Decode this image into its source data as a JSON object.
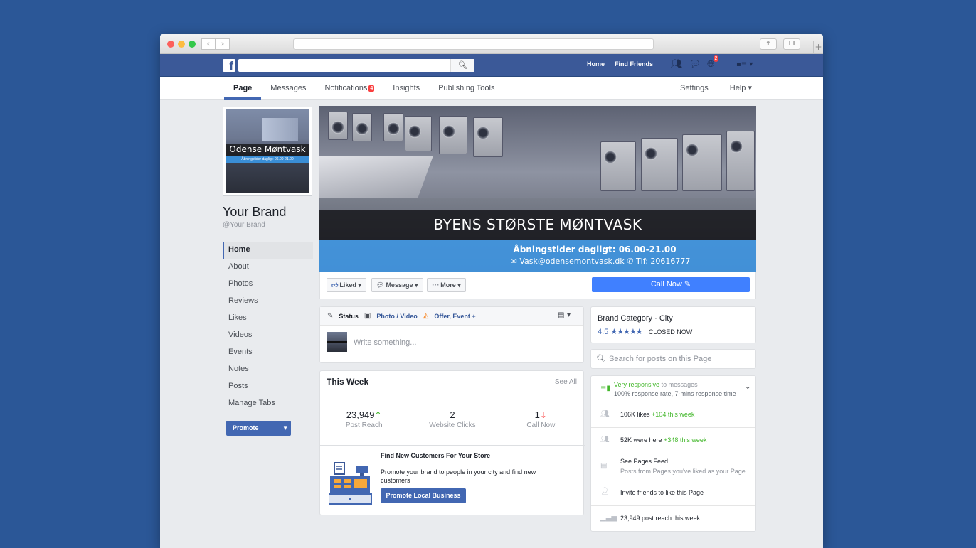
{
  "browser": {
    "back": "‹",
    "forward": "›"
  },
  "fbbar": {
    "logo": "f",
    "links": [
      "Home",
      "Find Friends"
    ],
    "requests_icon": "friends-icon",
    "messages_icon": "messages-icon",
    "notifications_icon": "globe-icon",
    "notifications_count": "2"
  },
  "pagenav": {
    "tabs": [
      {
        "label": "Page",
        "active": true
      },
      {
        "label": "Messages"
      },
      {
        "label": "Notifications",
        "badge": "4"
      },
      {
        "label": "Insights"
      },
      {
        "label": "Publishing Tools"
      }
    ],
    "right": [
      "Settings",
      "Help ▾"
    ]
  },
  "profile": {
    "avatar_name": "Odense Møntvask",
    "avatar_hours": "Åbningstider dagligt: 06.00-21.00",
    "name": "Your Brand",
    "handle": "@Your Brand"
  },
  "sidebar": {
    "items": [
      "Home",
      "About",
      "Photos",
      "Reviews",
      "Likes",
      "Videos",
      "Events",
      "Notes",
      "Posts",
      "Manage Tabs"
    ],
    "promote": "Promote"
  },
  "cover": {
    "title": "BYENS STØRSTE MØNTVASK",
    "hours": "Åbningstider dagligt: 06.00-21.00",
    "email": "Vask@odensemontvask.dk",
    "phone": "Tlf: 20616777"
  },
  "actions": {
    "liked": "Liked",
    "message": "Message",
    "more": "More",
    "call_now": "Call Now"
  },
  "composer": {
    "status": "Status",
    "photo": "Photo / Video",
    "offer": "Offer, Event +",
    "placeholder": "Write something..."
  },
  "thisweek": {
    "title": "This Week",
    "see_all": "See All",
    "stats": [
      {
        "value": "23,949",
        "label": "Post Reach",
        "trend": "up"
      },
      {
        "value": "2",
        "label": "Website Clicks",
        "trend": ""
      },
      {
        "value": "1",
        "label": "Call Now",
        "trend": "down"
      }
    ],
    "promo_title": "Find New Customers For Your Store",
    "promo_desc": "Promote your brand to people in your city and find new customers",
    "promo_button": "Promote Local Business"
  },
  "category": {
    "text": "Brand Category · City",
    "rating": "4.5",
    "stars": 4.5,
    "status": "CLOSED NOW"
  },
  "page_search": {
    "placeholder": "Search for posts on this Page"
  },
  "info": {
    "responsive": "Very responsive",
    "responsive_suffix": "to messages",
    "response_rate": "100% response rate, 7-mins response time",
    "likes": "106K likes",
    "likes_delta": "+104 this week",
    "checkins": "52K were here",
    "checkins_delta": "+348 this week",
    "feed_title": "See Pages Feed",
    "feed_desc": "Posts from Pages you've liked as your Page",
    "invite": "Invite friends to like this Page",
    "reach": "23,949 post reach this week"
  },
  "colors": {
    "background": "#2b5797",
    "fb_blue": "#3b5998",
    "button_blue": "#4267b2",
    "call_now": "#4080ff",
    "green": "#42b72a",
    "red": "#fa3e3e"
  }
}
